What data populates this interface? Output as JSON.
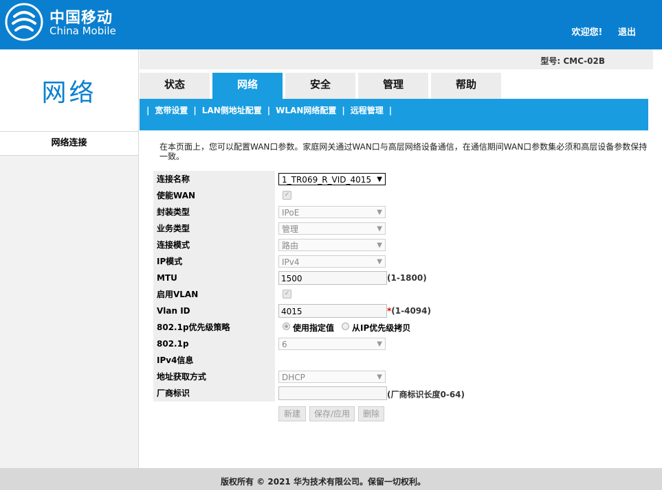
{
  "header": {
    "brand_cn": "中国移动",
    "brand_en": "China Mobile",
    "welcome": "欢迎您!",
    "logout": "退出",
    "brand_color": "#0a7fcf"
  },
  "model": "型号: CMC-02B",
  "sidebar": {
    "title": "网络",
    "item": "网络连接"
  },
  "tabs": [
    {
      "label": "状态",
      "active": false
    },
    {
      "label": "网络",
      "active": true
    },
    {
      "label": "安全",
      "active": false
    },
    {
      "label": "管理",
      "active": false
    },
    {
      "label": "帮助",
      "active": false
    }
  ],
  "subnav": [
    "宽带设置",
    "LAN侧地址配置",
    "WLAN网络配置",
    "远程管理"
  ],
  "description": "在本页面上，您可以配置WAN口参数。家庭网关通过WAN口与高层网络设备通信，在通信期间WAN口参数集必须和高层设备参数保持一致。",
  "form": {
    "connection_name": {
      "label": "连接名称",
      "value": "1_TR069_R_VID_4015"
    },
    "enable_wan": {
      "label": "使能WAN",
      "checked": true
    },
    "encapsulation": {
      "label": "封装类型",
      "value": "IPoE"
    },
    "service_type": {
      "label": "业务类型",
      "value": "管理"
    },
    "connection_mode": {
      "label": "连接模式",
      "value": "路由"
    },
    "ip_mode": {
      "label": "IP模式",
      "value": "IPv4"
    },
    "mtu": {
      "label": "MTU",
      "value": "1500",
      "hint": "(1-1800)"
    },
    "enable_vlan": {
      "label": "启用VLAN",
      "checked": true
    },
    "vlan_id": {
      "label": "Vlan ID",
      "value": "4015",
      "required": "*",
      "hint": "(1-4094)"
    },
    "priority_policy": {
      "label": "802.1p优先级策略",
      "option1": "使用指定值",
      "option2": "从IP优先级拷贝"
    },
    "p8021": {
      "label": "802.1p",
      "value": "6"
    },
    "ipv4_info": {
      "label": "IPv4信息"
    },
    "addr_mode": {
      "label": "地址获取方式",
      "value": "DHCP"
    },
    "vendor_id": {
      "label": "厂商标识",
      "value": "",
      "hint": "(厂商标识长度0-64)"
    }
  },
  "buttons": {
    "new": "新建",
    "save": "保存/应用",
    "delete": "删除"
  },
  "footer": "版权所有 © 2021 华为技术有限公司。保留一切权利。"
}
